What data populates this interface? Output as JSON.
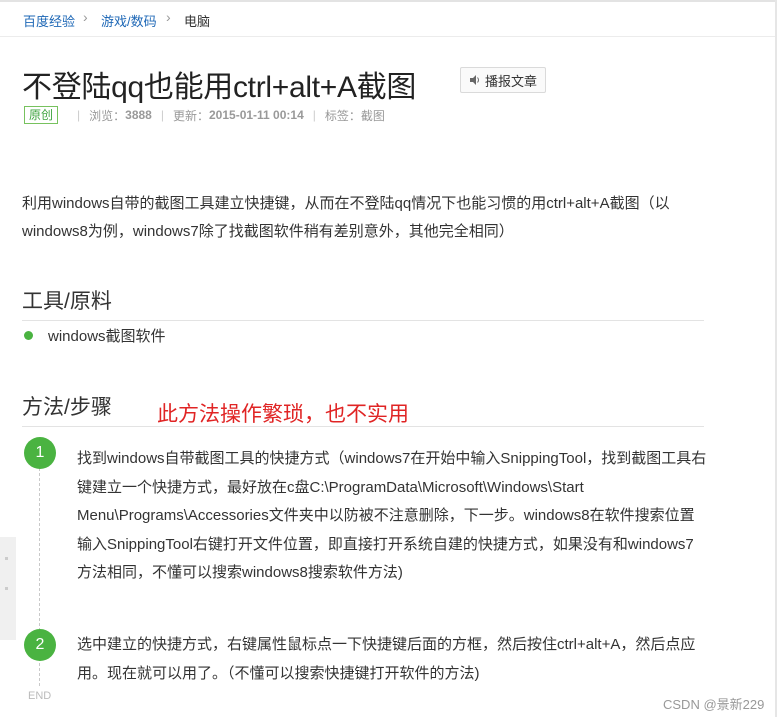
{
  "breadcrumb": {
    "items": [
      "百度经验",
      "游戏/数码",
      "电脑"
    ],
    "separator": "›"
  },
  "article": {
    "title": "不登陆qq也能用ctrl+alt+A截图",
    "report_button": "播报文章",
    "meta": {
      "badge": "原创",
      "views_label": "浏览：",
      "views": "3888",
      "updated_label": "更新：",
      "updated": "2015-01-11 00:14",
      "tags_label": "标签：",
      "tags": "截图"
    },
    "intro": "利用windows自带的截图工具建立快捷键，从而在不登陆qq情况下也能习惯的用ctrl+alt+A截图（以windows8为例，windows7除了找截图软件稍有差别意外，其他完全相同）",
    "tools_heading": "工具/原料",
    "tools": [
      "windows截图软件"
    ],
    "steps_heading": "方法/步骤",
    "annotation": "此方法操作繁琐，也不实用",
    "steps": [
      {
        "number": "1",
        "text": "找到windows自带截图工具的快捷方式（windows7在开始中输入SnippingTool，找到截图工具右键建立一个快捷方式，最好放在c盘C:\\ProgramData\\Microsoft\\Windows\\Start Menu\\Programs\\Accessories文件夹中以防被不注意删除，下一步。windows8在软件搜索位置输入SnippingTool右键打开文件位置，即直接打开系统自建的快捷方式，如果没有和windows7方法相同，不懂可以搜索windows8搜索软件方法)"
      },
      {
        "number": "2",
        "text": "选中建立的快捷方式，右键属性鼠标点一下快捷键后面的方框，然后按住ctrl+alt+A，然后点应用。现在就可以用了。（不懂可以搜索快捷键打开软件的方法)"
      }
    ],
    "end_label": "END"
  },
  "watermark": "CSDN @景新229",
  "colors": {
    "link": "#1d67b6",
    "accent_green": "#4ab341",
    "annotation_red": "#e02424"
  },
  "icons": {
    "report": "speaker-icon"
  }
}
